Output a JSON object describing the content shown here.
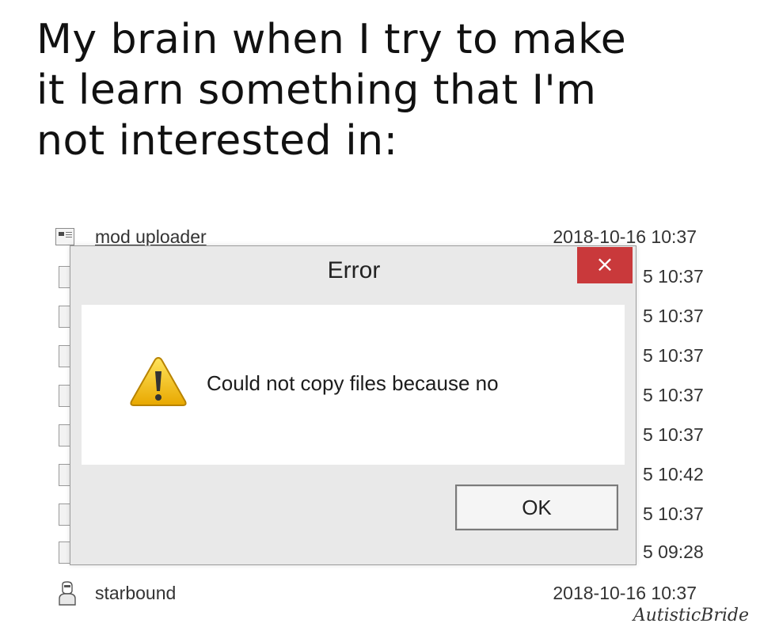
{
  "caption": {
    "line1": "My brain when I try to make",
    "line2": "it learn something that I'm",
    "line3": "not interested in:"
  },
  "explorer": {
    "first_row": {
      "name": "mod uploader",
      "date": "2018-10-16 10:37",
      "icon": "app-window-icon"
    },
    "hidden_times": [
      "5 10:37",
      "5 10:37",
      "5 10:37",
      "5 10:37",
      "5 10:37",
      "5 10:42",
      "5 10:37",
      "5 09:28"
    ],
    "last_row": {
      "name": "starbound",
      "date": "2018-10-16 10:37",
      "icon": "user-folder-icon"
    }
  },
  "dialog": {
    "title": "Error",
    "close_label": "×",
    "message": "Could not copy files because no",
    "ok_label": "OK",
    "icon": "warning-icon",
    "close_color": "#c9393b"
  },
  "watermark": "AutisticBride"
}
